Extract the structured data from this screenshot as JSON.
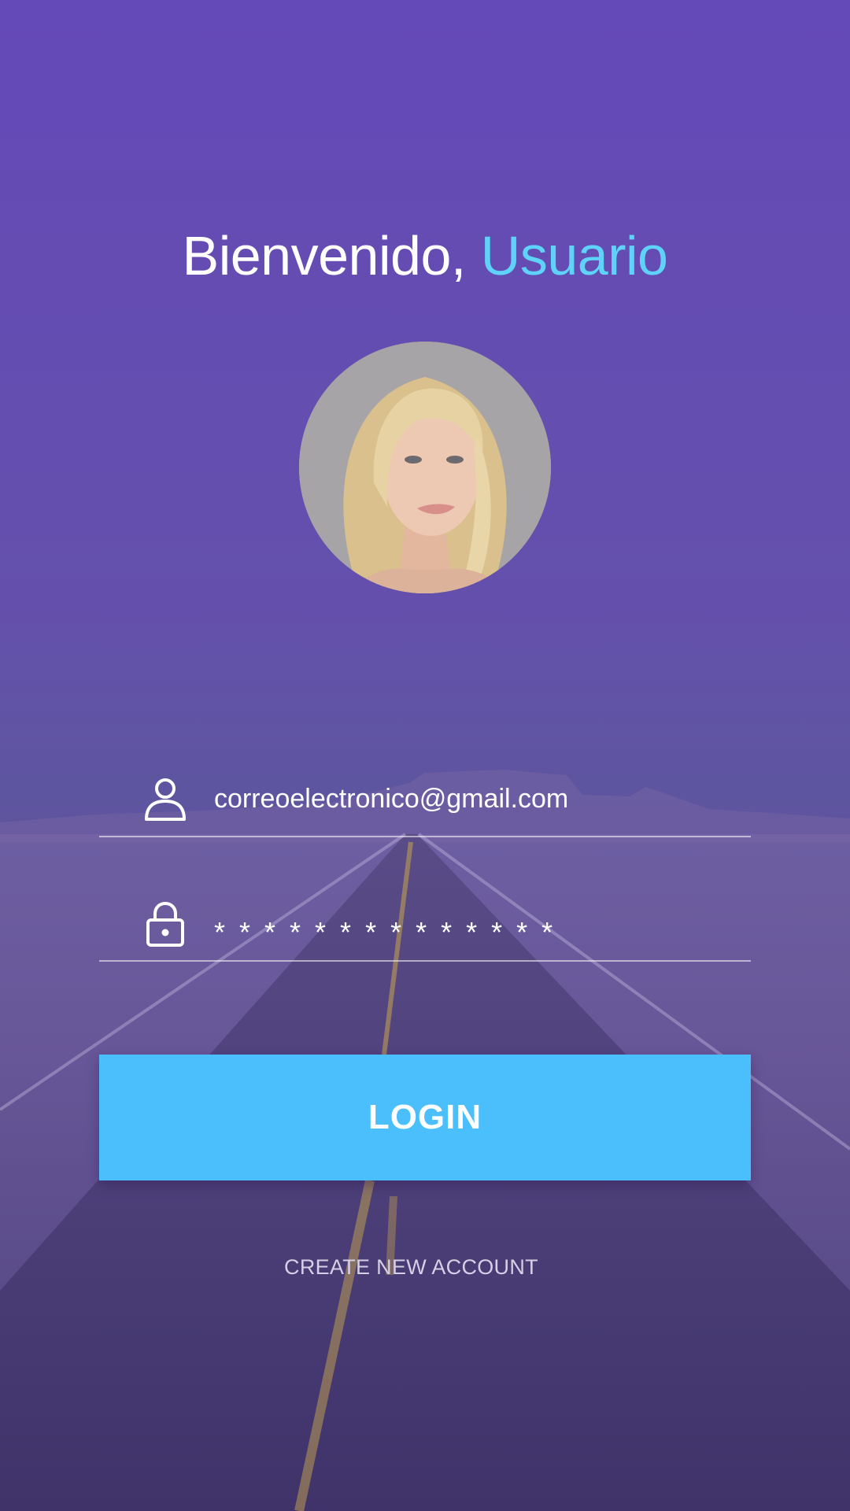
{
  "welcome": {
    "greeting": "Bienvenido,",
    "user_name": "Usuario"
  },
  "avatar": {
    "icon": "user-photo"
  },
  "email_field": {
    "value": "correoelectronico@gmail.com",
    "icon": "user-icon"
  },
  "password_field": {
    "value": "* * * * * * * * * * * * * *",
    "icon": "lock-icon"
  },
  "login_button": {
    "label": "LOGIN"
  },
  "create_account": {
    "label": "CREATE NEW ACCOUNT"
  },
  "colors": {
    "background_top": "#6449b8",
    "accent_name": "#5fd3f7",
    "button": "#4bbffb"
  }
}
